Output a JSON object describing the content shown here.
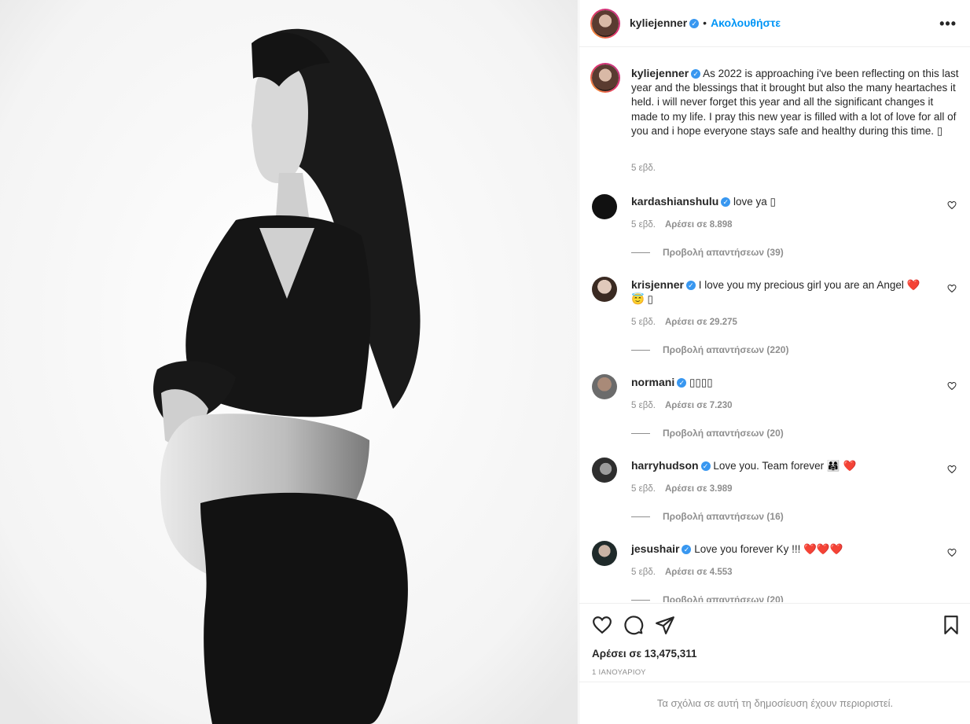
{
  "post": {
    "username": "kyliejenner",
    "follow_label": "Ακολουθήστε",
    "separator": "•",
    "more_label": "•••",
    "caption": "As 2022 is approaching i've been reflecting on this last year and the blessings that it brought but also the many heartaches it held. i will never forget this year and all the significant changes it made to my life. I pray this new year is filled with a lot of love for all of you and i hope everyone stays safe and healthy during this time. ▯",
    "caption_time": "5 εβδ.",
    "likes": "Αρέσει σε 13,475,311",
    "date": "1 ΙΑΝΟΥΑΡΙΟΥ",
    "comments_restricted": "Τα σχόλια σε αυτή τη δημοσίευση έχουν περιοριστεί."
  },
  "comments": [
    {
      "username": "kardashianshulu",
      "text": "love ya ▯",
      "time": "5 εβδ.",
      "likes": "Αρέσει σε 8.898",
      "replies": "Προβολή απαντήσεων (39)"
    },
    {
      "username": "krisjenner",
      "text": "I love you my precious girl you are an Angel ❤️😇 ▯",
      "time": "5 εβδ.",
      "likes": "Αρέσει σε 29.275",
      "replies": "Προβολή απαντήσεων (220)"
    },
    {
      "username": "normani",
      "text": "▯▯▯▯",
      "time": "5 εβδ.",
      "likes": "Αρέσει σε 7.230",
      "replies": "Προβολή απαντήσεων (20)"
    },
    {
      "username": "harryhudson",
      "text": "Love you. Team forever 👨‍👩‍👧 ❤️",
      "time": "5 εβδ.",
      "likes": "Αρέσει σε 3.989",
      "replies": "Προβολή απαντήσεων (16)"
    },
    {
      "username": "jesushair",
      "text": "Love you forever Ky !!! ❤️❤️❤️",
      "time": "5 εβδ.",
      "likes": "Αρέσει σε 4.553",
      "replies": "Προβολή απαντήσεων (20)"
    }
  ],
  "icons": {
    "verified": "verified-badge-icon",
    "like": "heart-icon",
    "comment": "comment-bubble-icon",
    "share": "paper-plane-icon",
    "save": "bookmark-icon",
    "options": "more-options-icon"
  },
  "colors": {
    "accent": "#0095f6",
    "verified": "#3897f0",
    "muted": "#8e8e8e",
    "border": "#efefef"
  }
}
